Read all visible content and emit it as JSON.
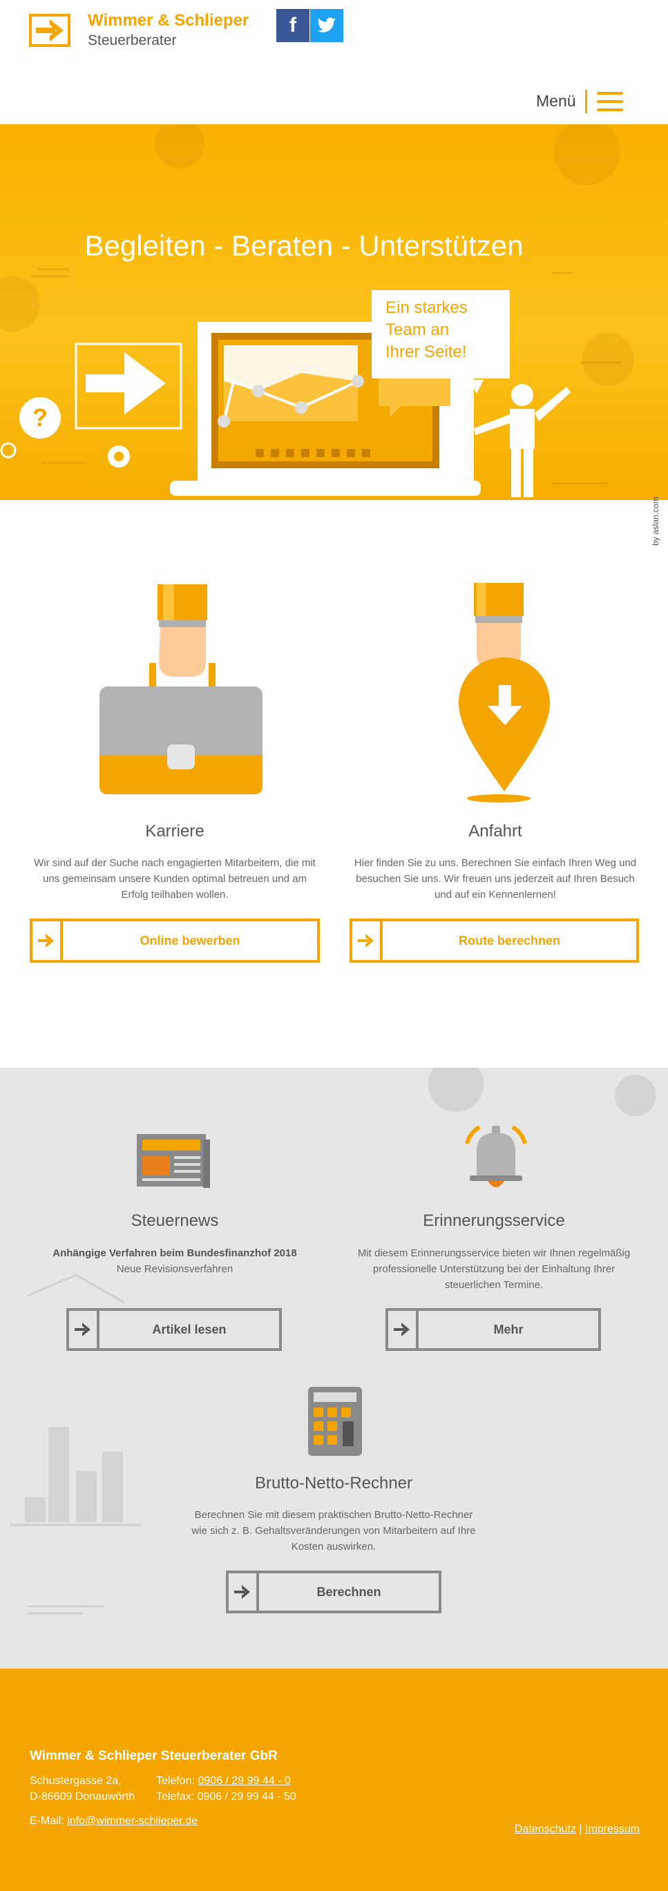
{
  "brand": {
    "name": "Wimmer & Schlieper",
    "subtitle": "Steuerberater"
  },
  "social": {
    "facebook": "f",
    "twitter": "twitter"
  },
  "nav": {
    "menu_label": "Menü"
  },
  "hero": {
    "headline": "Begleiten - Beraten - Unterstützen",
    "bubble_line1": "Ein starkes",
    "bubble_line2": "Team an",
    "bubble_line3": "Ihrer Seite!",
    "credit": "by aslan.com"
  },
  "services": [
    {
      "title": "Karriere",
      "text": "Wir sind auf der Suche nach engagierten Mitarbeitern, die mit uns gemeinsam unsere Kunden optimal betreuen und am Erfolg teilhaben wollen.",
      "button": "Online bewerben"
    },
    {
      "title": "Anfahrt",
      "text": "Hier finden Sie zu uns. Berechnen Sie einfach Ihren Weg und besuchen Sie uns. Wir freuen uns jederzeit auf Ihren Besuch und auf ein Kennenlernen!",
      "button": "Route berechnen"
    }
  ],
  "grey_services": [
    {
      "title": "Steuernews",
      "headline": "Anhängige Verfahren beim Bundesfinanzhof 2018",
      "text": "Neue Revisionsverfahren",
      "button": "Artikel lesen"
    },
    {
      "title": "Erinnerungsservice",
      "text": "Mit diesem Erinnerungsservice bieten wir Ihnen regelmäßig professionelle Unterstützung bei der Einhaltung Ihrer steuerlichen Termine.",
      "button": "Mehr"
    },
    {
      "title": "Brutto-Netto-Rechner",
      "text": "Berechnen Sie mit diesem praktischen Brutto-Netto-Rechner wie sich z. B. Gehaltsveränderungen von Mitarbeitern auf Ihre Kosten auswirken.",
      "button": "Berechnen"
    }
  ],
  "footer": {
    "company": "Wimmer & Schlieper Steuerberater GbR",
    "street": "Schustergasse 2a,",
    "city": "D-86609 Donauwörth",
    "phone_label": "Telefon:",
    "phone": "0906 / 29 99 44 - 0",
    "fax_label": "Telefax:",
    "fax": "0906 / 29 99 44 - 50",
    "email_label": "E-Mail:",
    "email": "info@wimmer-schlieper.de",
    "privacy": "Datenschutz",
    "separator": "|",
    "imprint": "Impressum"
  },
  "colors": {
    "accent": "#f5a500",
    "grey_bg": "#e6e6e6",
    "text": "#555555"
  }
}
